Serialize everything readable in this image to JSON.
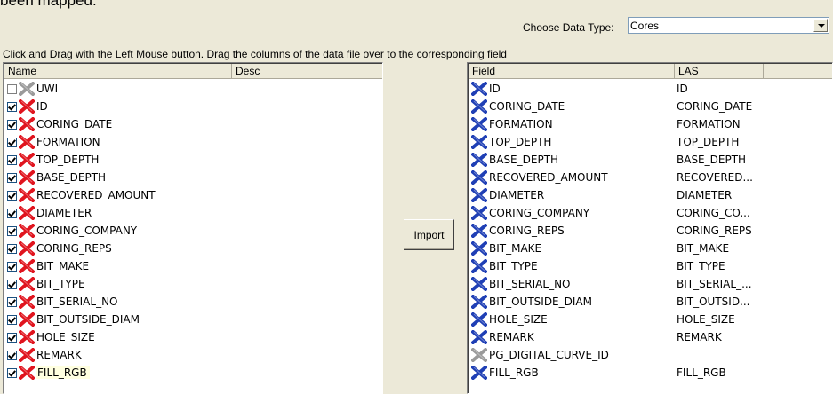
{
  "top_cut_text": "been mapped.",
  "data_type": {
    "label": "Choose Data Type:",
    "value": "Cores"
  },
  "instructions": "Click and Drag with the Left Mouse button. Drag the columns of the data file over to the corresponding field",
  "left_list": {
    "columns": [
      "Name",
      "Desc"
    ],
    "rows": [
      {
        "name": "UWI",
        "checked": false,
        "icon": "gray-x-icon"
      },
      {
        "name": "ID",
        "checked": true,
        "icon": "red-x-icon"
      },
      {
        "name": "CORING_DATE",
        "checked": true,
        "icon": "red-x-icon"
      },
      {
        "name": "FORMATION",
        "checked": true,
        "icon": "red-x-icon"
      },
      {
        "name": "TOP_DEPTH",
        "checked": true,
        "icon": "red-x-icon"
      },
      {
        "name": "BASE_DEPTH",
        "checked": true,
        "icon": "red-x-icon"
      },
      {
        "name": "RECOVERED_AMOUNT",
        "checked": true,
        "icon": "red-x-icon"
      },
      {
        "name": "DIAMETER",
        "checked": true,
        "icon": "red-x-icon"
      },
      {
        "name": "CORING_COMPANY",
        "checked": true,
        "icon": "red-x-icon"
      },
      {
        "name": "CORING_REPS",
        "checked": true,
        "icon": "red-x-icon"
      },
      {
        "name": "BIT_MAKE",
        "checked": true,
        "icon": "red-x-icon"
      },
      {
        "name": "BIT_TYPE",
        "checked": true,
        "icon": "red-x-icon"
      },
      {
        "name": "BIT_SERIAL_NO",
        "checked": true,
        "icon": "red-x-icon"
      },
      {
        "name": "BIT_OUTSIDE_DIAM",
        "checked": true,
        "icon": "red-x-icon"
      },
      {
        "name": "HOLE_SIZE",
        "checked": true,
        "icon": "red-x-icon"
      },
      {
        "name": "REMARK",
        "checked": true,
        "icon": "red-x-icon"
      },
      {
        "name": "FILL_RGB",
        "checked": true,
        "icon": "red-x-icon",
        "selected": true
      }
    ]
  },
  "import_button": {
    "label_underlined": "I",
    "label_rest": "mport"
  },
  "right_list": {
    "columns": [
      "Field",
      "LAS"
    ],
    "rows": [
      {
        "field": "ID",
        "las": "ID",
        "icon": "blue-x-icon"
      },
      {
        "field": "CORING_DATE",
        "las": "CORING_DATE",
        "icon": "blue-x-icon"
      },
      {
        "field": "FORMATION",
        "las": "FORMATION",
        "icon": "blue-x-icon"
      },
      {
        "field": "TOP_DEPTH",
        "las": "TOP_DEPTH",
        "icon": "blue-x-icon"
      },
      {
        "field": "BASE_DEPTH",
        "las": "BASE_DEPTH",
        "icon": "blue-x-icon"
      },
      {
        "field": "RECOVERED_AMOUNT",
        "las": "RECOVERED...",
        "icon": "blue-x-icon"
      },
      {
        "field": "DIAMETER",
        "las": "DIAMETER",
        "icon": "blue-x-icon"
      },
      {
        "field": "CORING_COMPANY",
        "las": "CORING_CO...",
        "icon": "blue-x-icon"
      },
      {
        "field": "CORING_REPS",
        "las": "CORING_REPS",
        "icon": "blue-x-icon"
      },
      {
        "field": "BIT_MAKE",
        "las": "BIT_MAKE",
        "icon": "blue-x-icon"
      },
      {
        "field": "BIT_TYPE",
        "las": "BIT_TYPE",
        "icon": "blue-x-icon"
      },
      {
        "field": "BIT_SERIAL_NO",
        "las": "BIT_SERIAL_...",
        "icon": "blue-x-icon"
      },
      {
        "field": "BIT_OUTSIDE_DIAM",
        "las": "BIT_OUTSID...",
        "icon": "blue-x-icon"
      },
      {
        "field": "HOLE_SIZE",
        "las": "HOLE_SIZE",
        "icon": "blue-x-icon"
      },
      {
        "field": "REMARK",
        "las": "REMARK",
        "icon": "blue-x-icon"
      },
      {
        "field": "PG_DIGITAL_CURVE_ID",
        "las": "",
        "icon": "gray-x-icon"
      },
      {
        "field": "FILL_RGB",
        "las": "FILL_RGB",
        "icon": "blue-x-icon"
      }
    ]
  },
  "colors": {
    "red_icon": "#e0141e",
    "blue_icon": "#1f3fb5",
    "gray_icon": "#9a9a9a",
    "selected_bg": "#ffffe0"
  }
}
